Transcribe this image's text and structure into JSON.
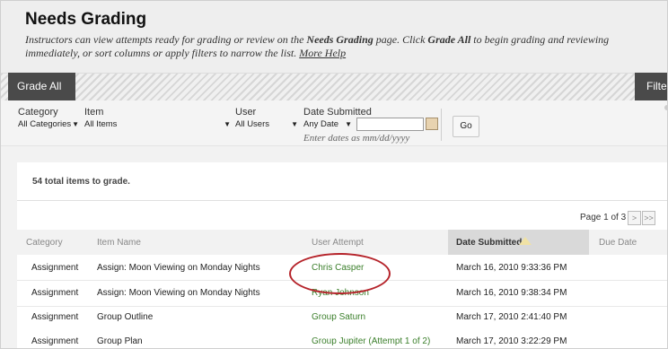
{
  "page": {
    "title": "Needs Grading",
    "description_parts": {
      "a": "Instructors can view attempts ready for grading or review on the ",
      "b": "Needs Grading",
      "c": " page. Click ",
      "d": "Grade All",
      "e": " to begin grading and reviewing immediately, or sort columns or apply filters to narrow the list. ",
      "help_link": "More Help"
    }
  },
  "actions": {
    "grade_all": "Grade All",
    "filter": "Filter"
  },
  "filters": {
    "category": {
      "label": "Category",
      "value": "All Categories"
    },
    "item": {
      "label": "Item",
      "value": "All Items"
    },
    "user": {
      "label": "User",
      "value": "All Users"
    },
    "date": {
      "label": "Date Submitted",
      "value": "Any Date",
      "hint": "Enter dates as mm/dd/yyyy",
      "input_value": ""
    },
    "go": "Go"
  },
  "summary": {
    "total": "54 total items to grade."
  },
  "pager": {
    "label": "Page 1 of 3",
    "next": ">",
    "last": ">>"
  },
  "table": {
    "headers": {
      "category": "Category",
      "item_name": "Item Name",
      "user_attempt": "User Attempt",
      "date_submitted": "Date Submitted",
      "due_date": "Due Date"
    },
    "rows": [
      {
        "category": "Assignment",
        "item": "Assign: Moon Viewing on Monday Nights",
        "user": "Chris Casper",
        "date": "March 16, 2010 9:33:36 PM"
      },
      {
        "category": "Assignment",
        "item": "Assign: Moon Viewing on Monday Nights",
        "user": "Ryan Johnson",
        "date": "March 16, 2010 9:38:34 PM"
      },
      {
        "category": "Assignment",
        "item": "Group Outline",
        "user": "Group Saturn",
        "date": "March 17, 2010 2:41:40 PM"
      },
      {
        "category": "Assignment",
        "item": "Group Plan",
        "user": "Group Jupiter (Attempt 1 of 2)",
        "date": "March 17, 2010 3:22:29 PM"
      }
    ]
  },
  "colors": {
    "link_green": "#3b7f2b",
    "annotation_red": "#b5232a",
    "dark_button": "#4a4a4a"
  },
  "icons": {
    "calendar": "calendar-icon",
    "sort": "sort-ascending-icon",
    "dropdown": "chevron-down-icon"
  }
}
